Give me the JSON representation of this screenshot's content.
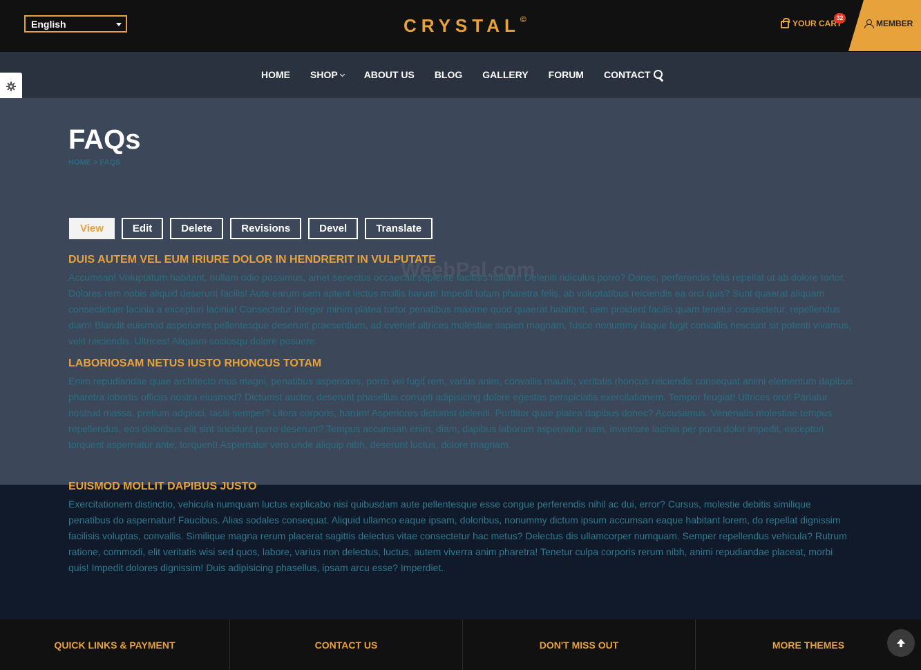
{
  "header": {
    "language": "English",
    "logo": "CRYSTAL",
    "logo_mark": "©",
    "cart_label": "YOUR CART",
    "cart_count": "32",
    "member_label": "MEMBER"
  },
  "nav": {
    "items": [
      "HOME",
      "SHOP",
      "ABOUT US",
      "BLOG",
      "GALLERY",
      "FORUM",
      "CONTACT"
    ]
  },
  "page": {
    "title": "FAQs",
    "breadcrumb": "HOME > FAQS",
    "watermark": "WeebPal.com"
  },
  "tabs": [
    "View",
    "Edit",
    "Delete",
    "Revisions",
    "Devel",
    "Translate"
  ],
  "faqs": [
    {
      "question": "DUIS AUTEM VEL EUM IRIURE DOLOR IN HENDRERIT IN VULPUTATE",
      "answer": "Accumsan! Voluptatum habitant, nullam odio possimus, amet senectus occaecati sapiente facilisis nullam! Deleniti ridiculus porro? Donec, perferendis felis repellat ut ab dolore tortor. Dolores rem nobis aliquid deserunt facilis! Aute earum sem aptent lectus mollis harum! Impedit totam pharetra felis, ab voluptatibus reiciendis ea orci quis? Sunt quaerat aliquam consectetuer lacinia a excepturi lacinia! Consectetur integer minim platea tortor penatibus maxime quod quaerat habitant, sem proident facilis quam tenetur consectetur, repellendus diam! Blandit euismod asperiores pellentesque deserunt praesentium, ad eveniet ultrices molestiae sapien magnam, fusce nonummy itaque fugit convallis nesciunt sit potenti vivamus, velit reiciendis. Ultrices! Aliquam sociosqu dolore posuere."
    },
    {
      "question": "LABORIOSAM NETUS IUSTO RHONCUS TOTAM",
      "answer": "Enim repudiandae quae architecto mus magni, penatibus asperiores, porro vel fugit rem, varius anim, convallis mauris, veritatis rhoncus reiciendis consequat animi elementum dapibus pharetra lobortis officiis nostra eiusmod? Dictumst auctor, deserunt phasellus corrupti adipisicing dolore egestas perspiciatis exercitationem. Tempor feugiat! Ultrices orci! Pariatur nostrud massa, pretium adipisci, taciti semper? Litora corporis, harum! Asperiores dictumst deleniti. Porttitor quae platea dapibus donec? Accusamus. Venenatis molestiae tempus repellendus, eos doloribus elit sint tincidunt porro deserunt? Tempus accumsan enim, diam, dapibus laborum aspernatur nam, inventore lacinia per porta dolor impedit, excepturi torquent aspernatur ante, torquent! Aspernatur vero unde aliquip nibh, deserunt luctus, dolore magnam."
    },
    {
      "question": "EUISMOD MOLLIT DAPIBUS JUSTO",
      "answer": "Exercitationem distinctio, vehicula numquam luctus explicabo nisi quibusdam aute pellentesque esse congue perferendis nihil ac dui, error? Cursus, molestie debitis similique penatibus do aspernatur! Faucibus. Alias sodales consequat. Aliquid ullamco eaque ipsam, doloribus, nonummy dictum ipsum accumsan eaque habitant lorem, do repellat dignissim facilisis voluptas, convallis. Similique magna rerum placerat sagittis delectus vitae consectetur hac metus? Delectus dis ullamcorper numquam. Semper repellendus vehicula? Rutrum ratione, commodi, elit veritatis wisi sed quos, labore, varius non delectus, luctus, autem viverra anim pharetra! Tenetur culpa corporis rerum nibh, animi repudiandae placeat, morbi quis! Impedit dolores dignissim! Duis adipisicing phasellus, ipsam arcu esse? Imperdiet."
    }
  ],
  "footer": {
    "columns": [
      "QUICK LINKS & PAYMENT",
      "CONTACT US",
      "DON'T MISS OUT",
      "MORE THEMES"
    ]
  },
  "colors": {
    "accent": "#e7a23b",
    "topbar": "#111111",
    "nav": "#2a3240",
    "overlay": "#3c4759",
    "background": "#111a2a"
  }
}
